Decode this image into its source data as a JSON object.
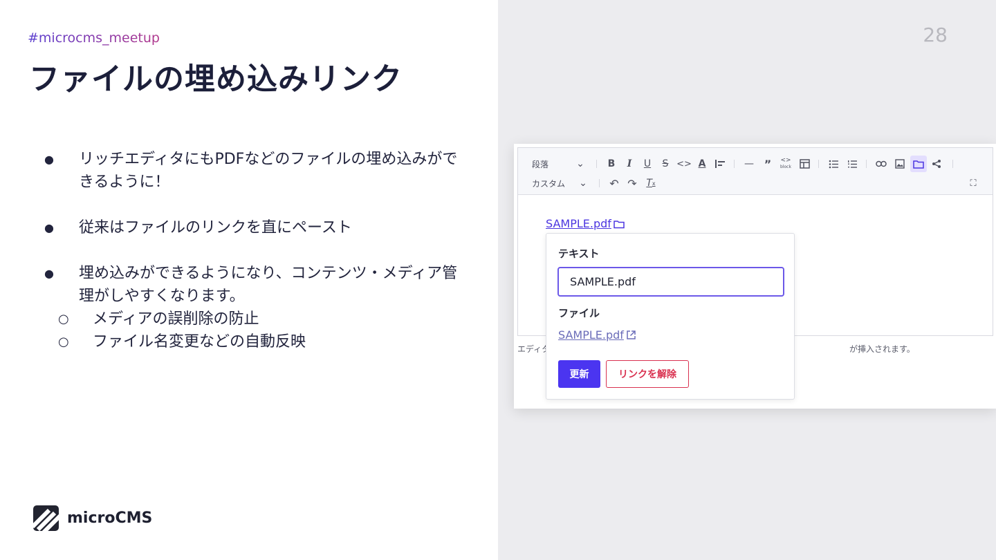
{
  "slide": {
    "hashtag": "#microcms_meetup",
    "title": "ファイルの埋め込みリンク",
    "page_number": "28",
    "brand": "microCMS",
    "bullets": [
      {
        "text": "リッチエディタにもPDFなどのファイルの埋め込みができるように！"
      },
      {
        "text": "従来はファイルのリンクを直にペースト"
      },
      {
        "text": "埋め込みができるようになり、コンテンツ・メディア管理がしやすくなります。",
        "subitems": [
          "メディアの誤削除の防止",
          "ファイル名変更などの自動反映"
        ]
      }
    ]
  },
  "editor": {
    "toolbar": {
      "paragraph_select": "段落",
      "custom_select": "カスタム"
    },
    "content_link": "SAMPLE.pdf",
    "hint_left": "エディタ",
    "hint_right": "が挿入されます。"
  },
  "popover": {
    "text_label": "テキスト",
    "text_value": "SAMPLE.pdf",
    "file_label": "ファイル",
    "file_link": "SAMPLE.pdf",
    "update_button": "更新",
    "unlink_button": "リンクを解除"
  },
  "colors": {
    "accent": "#4b35f0",
    "danger": "#d9304f",
    "right_bg": "#ececef"
  }
}
